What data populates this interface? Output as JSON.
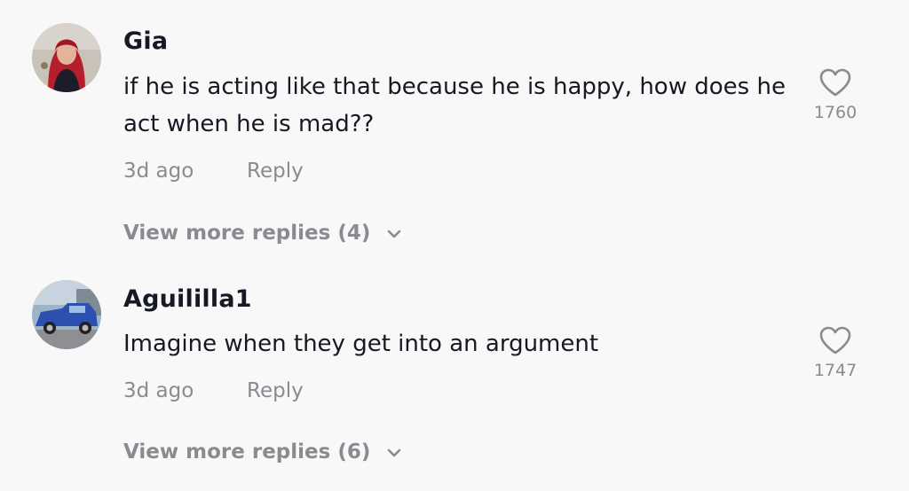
{
  "comments": [
    {
      "username": "Gia",
      "text": "if he is acting like that because he is happy, how does he act when he is mad??",
      "time": "3d ago",
      "reply_label": "Reply",
      "likes": "1760",
      "view_more": "View more replies (4)"
    },
    {
      "username": "Aguililla1",
      "text": "Imagine when they get into an argument",
      "time": "3d ago",
      "reply_label": "Reply",
      "likes": "1747",
      "view_more": "View more replies (6)"
    }
  ],
  "icons": {
    "like": "heart-outline-icon",
    "expand": "chevron-down-icon"
  },
  "colors": {
    "background": "#f8f8f8",
    "primary_text": "#161823",
    "secondary_text": "#8a8b91"
  }
}
